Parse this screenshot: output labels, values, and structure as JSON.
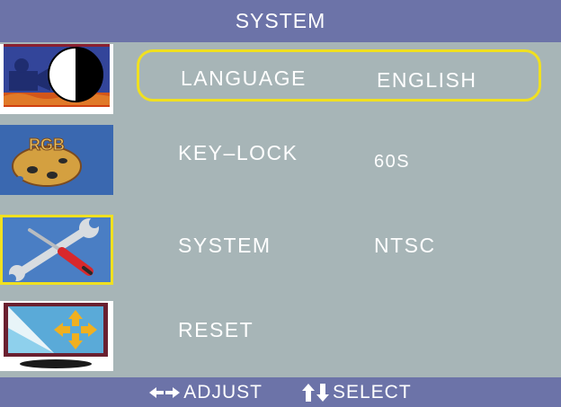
{
  "header": {
    "title": "SYSTEM"
  },
  "sidebar": {
    "items": [
      {
        "name": "picture",
        "icon": "picture-contrast-icon"
      },
      {
        "name": "rgb",
        "icon": "rgb-palette-icon",
        "label": "RGB"
      },
      {
        "name": "system",
        "icon": "wrench-screwdriver-icon",
        "active": true
      },
      {
        "name": "screen",
        "icon": "screen-position-icon"
      }
    ]
  },
  "menu": {
    "rows": [
      {
        "label": "LANGUAGE",
        "value": "ENGLISH",
        "selected": true
      },
      {
        "label": "KEY–LOCK",
        "value": "60S"
      },
      {
        "label": "SYSTEM",
        "value": "NTSC"
      },
      {
        "label": "RESET",
        "value": ""
      }
    ]
  },
  "footer": {
    "adjust_label": "ADJUST",
    "select_label": "SELECT"
  },
  "colors": {
    "background": "#a7b5b7",
    "bar": "#6c73a8",
    "highlight": "#f0e020",
    "text": "#ffffff"
  }
}
